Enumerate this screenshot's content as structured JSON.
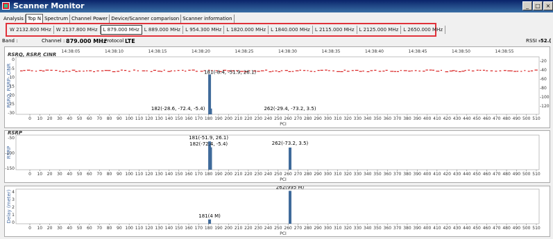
{
  "window": {
    "title": "Scanner Monitor",
    "minimize": "_",
    "restore": "□",
    "close": "×"
  },
  "tabs": [
    "Analysis",
    "Top N",
    "Spectrum",
    "Channel Power",
    "Device/Scanner comparison",
    "Scanner information"
  ],
  "active_tab": "Top N",
  "frequencies": [
    "W 2132.800 MHz",
    "W 2137.800 MHz",
    "L 879.000 MHz",
    "L 889.000 MHz",
    "L 954.300 MHz",
    "L 1820.000 MHz",
    "L 1840.000 MHz",
    "L 2115.000 MHz",
    "L 2125.000 MHz",
    "L 2650.000 MHz"
  ],
  "active_frequency": "L 879.000 MHz",
  "info": {
    "band_label": "Band :",
    "channel_label": "Channel :",
    "channel_value": "879.000 MHz",
    "protocol_label": "Protocol :",
    "protocol_value": "LTE",
    "rssi_label": "RSSI :",
    "rssi_value": "-52.("
  },
  "colors": {
    "bar": "#3f6a9a",
    "scatter": "#d81e1e",
    "accent_box": "#e0323a"
  },
  "chart_data": [
    {
      "type": "scatter",
      "title": "RSRQ, RSRP, CINR",
      "ylabel": "RSRQ, RSRP, CINR",
      "xlabel": "PCI",
      "x_ticks": [
        0,
        10,
        20,
        30,
        40,
        50,
        60,
        70,
        80,
        90,
        100,
        110,
        120,
        130,
        140,
        150,
        160,
        170,
        180,
        190,
        200,
        210,
        220,
        230,
        240,
        250,
        260,
        270,
        280,
        290,
        300,
        310,
        320,
        330,
        340,
        350,
        360,
        370,
        380,
        390,
        400,
        410,
        420,
        430,
        440,
        450,
        460,
        470,
        480,
        490,
        500,
        510
      ],
      "time_ticks": [
        "14:38:05",
        "14:38:10",
        "14:38:15",
        "14:38:20",
        "14:38:25",
        "14:38:30",
        "14:38:35",
        "14:38:40",
        "14:38:45",
        "14:38:50",
        "14:38:55"
      ],
      "y_ticks_left": [
        "0",
        "-5",
        "-10",
        "-15",
        "-20",
        "-25",
        "-30"
      ],
      "y_ticks_right": [
        "-20",
        "-40",
        "-60",
        "-80",
        "-100",
        "-120"
      ],
      "ylim": [
        -32,
        2
      ],
      "bars": [
        {
          "x": 181,
          "y": -8.4,
          "label": "181(-8.4, -51.9, 26.1)"
        },
        {
          "x": 182,
          "y": -28.6,
          "label": "182(-28.6, -72.4, -5.4)"
        }
      ],
      "annotations": [
        {
          "x": 262,
          "label": "262(-29.4, -73.2, 3.5)"
        }
      ],
      "scatter_band": -6.5,
      "legend": "none",
      "grid": false
    },
    {
      "type": "bar",
      "title": "RSRP",
      "ylabel": "RSRP",
      "xlabel": "PCI",
      "y_ticks_left": [
        "-50",
        "-100",
        "-150"
      ],
      "ylim": [
        -150,
        -30
      ],
      "bars": [
        {
          "x": 181,
          "y": -51.9,
          "label": "181(-51.9, 26.1)"
        },
        {
          "x": 182,
          "y": -72.4,
          "label": "182(-72.4, -5.4)"
        },
        {
          "x": 262,
          "y": -73.2,
          "label": "262(-73.2, 3.5)"
        }
      ],
      "legend": "none",
      "grid": false
    },
    {
      "type": "bar",
      "title": "",
      "ylabel": "Delay (meter)",
      "xlabel": "PCI",
      "y_ticks_left": [
        "4",
        "3",
        "2",
        "1",
        "0"
      ],
      "ylim": [
        0,
        4
      ],
      "bars": [
        {
          "x": 181,
          "y": 0.5,
          "label": "181(4 M)"
        },
        {
          "x": 262,
          "y": 3.8,
          "label": "262(995 M)"
        }
      ],
      "legend": "none",
      "grid": false
    }
  ]
}
